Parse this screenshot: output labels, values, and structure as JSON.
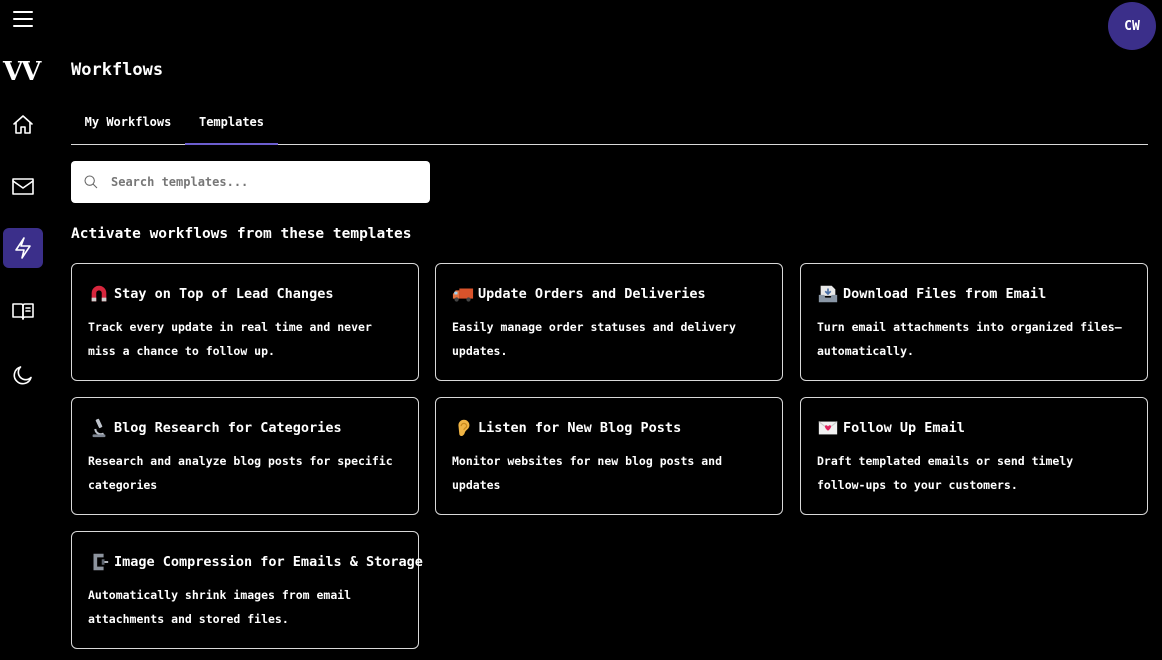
{
  "app": {
    "logo": "VV",
    "avatar_initials": "CW"
  },
  "sidebar": {
    "items": [
      {
        "name": "home",
        "icon": "home-icon"
      },
      {
        "name": "inbox",
        "icon": "mail-icon"
      },
      {
        "name": "workflows",
        "icon": "lightning-icon",
        "active": true
      },
      {
        "name": "docs",
        "icon": "book-icon"
      },
      {
        "name": "theme",
        "icon": "moon-icon"
      }
    ],
    "accent": "#3b2f8a"
  },
  "header": {
    "title": "Workflows"
  },
  "tabs": [
    {
      "label": "My Workflows"
    },
    {
      "label": "Templates",
      "active": true
    }
  ],
  "search": {
    "placeholder": "Search templates..."
  },
  "section": {
    "title": "Activate workflows from these templates"
  },
  "templates": [
    {
      "emoji": "magnet",
      "title": "Stay on Top of Lead Changes",
      "description": "Track every update in real time and never miss a chance to follow up."
    },
    {
      "emoji": "delivery-truck",
      "title": "Update Orders and Deliveries",
      "description": "Easily manage order statuses and delivery updates."
    },
    {
      "emoji": "inbox-tray",
      "title": "Download Files from Email",
      "description": "Turn email attachments into organized files—automatically."
    },
    {
      "emoji": "microscope",
      "title": "Blog Research for Categories",
      "description": "Research and analyze blog posts for specific categories"
    },
    {
      "emoji": "ear",
      "title": "Listen for New Blog Posts",
      "description": "Monitor websites for new blog posts and updates"
    },
    {
      "emoji": "love-letter",
      "title": "Follow Up Email",
      "description": "Draft templated emails or send timely follow-ups to your customers."
    },
    {
      "emoji": "clamp",
      "title": "Image Compression for Emails & Storage",
      "description": "Automatically shrink images from email attachments and stored files."
    }
  ]
}
